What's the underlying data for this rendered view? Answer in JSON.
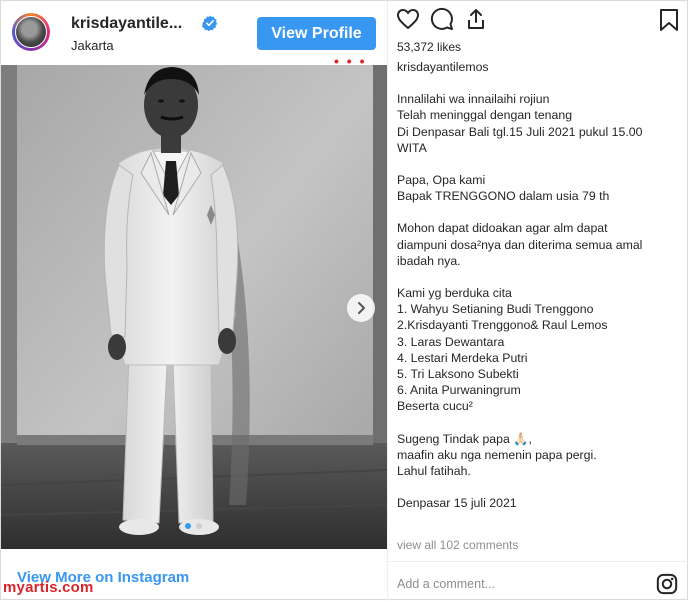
{
  "header": {
    "username": "krisdayantile...",
    "location": "Jakarta",
    "view_profile_label": "View Profile",
    "red_dots": "• • •"
  },
  "post": {
    "likes": "53,372 likes",
    "caption_lines": [
      "krisdayantilemos",
      "",
      "Innalilahi wa innailaihi rojiun",
      "Telah meninggal dengan tenang",
      "Di Denpasar Bali tgl.15 Juli 2021 pukul 15.00",
      "WITA",
      "",
      "Papa, Opa kami",
      "Bapak TRENGGONO dalam usia 79 th",
      "",
      "Mohon dapat didoakan agar alm dapat",
      "diampuni dosa²nya dan diterima semua amal",
      "ibadah nya.",
      "",
      "Kami yg berduka cita",
      "1. Wahyu Setianing Budi Trenggono",
      "2.Krisdayanti Trenggono& Raul Lemos",
      "3. Laras Dewantara",
      "4. Lestari Merdeka Putri",
      "5. Tri Laksono Subekti",
      "6. Anita Purwaningrum",
      "Beserta cucu²",
      "",
      "Sugeng Tindak papa 🙏🏻,",
      "maafin aku nga nemenin papa pergi.",
      "Lahul fatihah.",
      "",
      "Denpasar 15 juli 2021"
    ],
    "view_comments": "view all 102 comments",
    "add_comment_placeholder": "Add a comment..."
  },
  "footer": {
    "view_more": "View More on Instagram",
    "watermark": "myartis.com"
  },
  "carousel": {
    "slide_count": 2,
    "active_index": 0
  },
  "colors": {
    "accent": "#3897f0",
    "watermark": "#d8242a",
    "muted": "#8e8e8e"
  },
  "icons": [
    "verified-badge-icon",
    "heart-icon",
    "comment-icon",
    "share-icon",
    "bookmark-icon",
    "chevron-right-icon",
    "instagram-logo-icon"
  ]
}
